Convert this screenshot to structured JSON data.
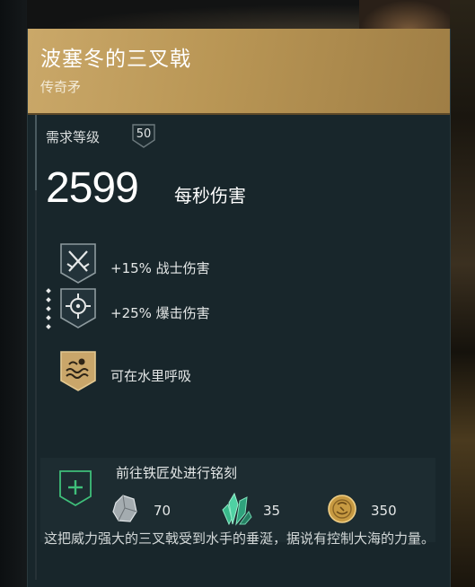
{
  "item": {
    "name": "波塞冬的三叉戟",
    "rarity": "传奇矛",
    "level_label": "需求等级",
    "level": "50",
    "dps_value": "2599",
    "dps_label": "每秒伤害"
  },
  "perks": [
    {
      "text": "+15% 战士伤害",
      "icon": "crossed-swords-icon"
    },
    {
      "text": "+25% 爆击伤害",
      "icon": "crosshair-icon"
    },
    {
      "text": "可在水里呼吸",
      "icon": "water-breathing-icon"
    }
  ],
  "engraving": {
    "label": "前往铁匠处进行铭刻",
    "materials": [
      {
        "name": "iron-ore-icon",
        "amount": "70"
      },
      {
        "name": "crystal-icon",
        "amount": "35"
      },
      {
        "name": "drachmae-coin-icon",
        "amount": "350"
      }
    ]
  },
  "description": "这把威力强大的三叉戟受到水手的垂涎，据说有控制大海的力量。",
  "colors": {
    "header_gold": "#caa869",
    "panel_bg": "#18262b",
    "engrave_green": "#3fbf7a"
  }
}
